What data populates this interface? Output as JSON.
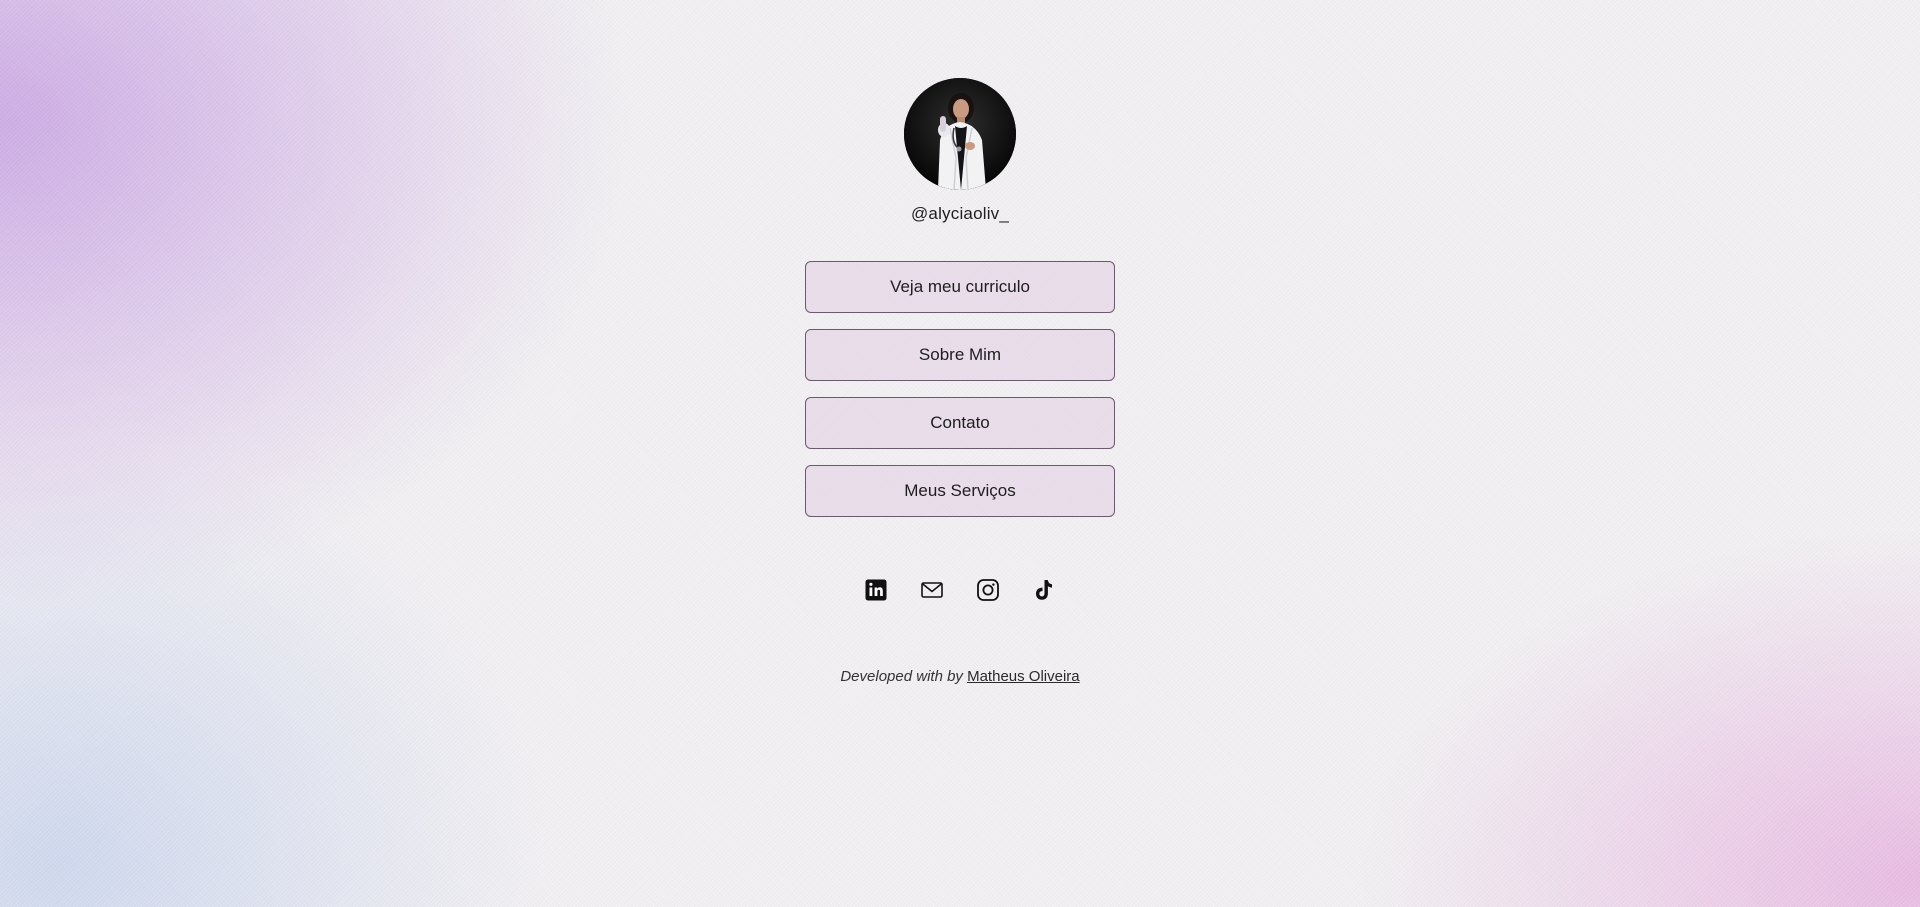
{
  "profile": {
    "handle": "@alyciaoliv_",
    "avatar_icon": "profile-photo"
  },
  "links": [
    {
      "label": "Veja meu curriculo"
    },
    {
      "label": "Sobre Mim"
    },
    {
      "label": "Contato"
    },
    {
      "label": "Meus Serviços"
    }
  ],
  "social": [
    {
      "icon": "linkedin-icon"
    },
    {
      "icon": "mail-icon"
    },
    {
      "icon": "instagram-icon"
    },
    {
      "icon": "tiktok-icon"
    }
  ],
  "footer": {
    "prefix": "Developed with by",
    "author": "Matheus Oliveira"
  },
  "colors": {
    "button_border": "#6b5a6e",
    "button_fill": "#e6d5e8",
    "gradient_left": "#cdaae6",
    "gradient_bottom_right": "#e8b4e1"
  }
}
